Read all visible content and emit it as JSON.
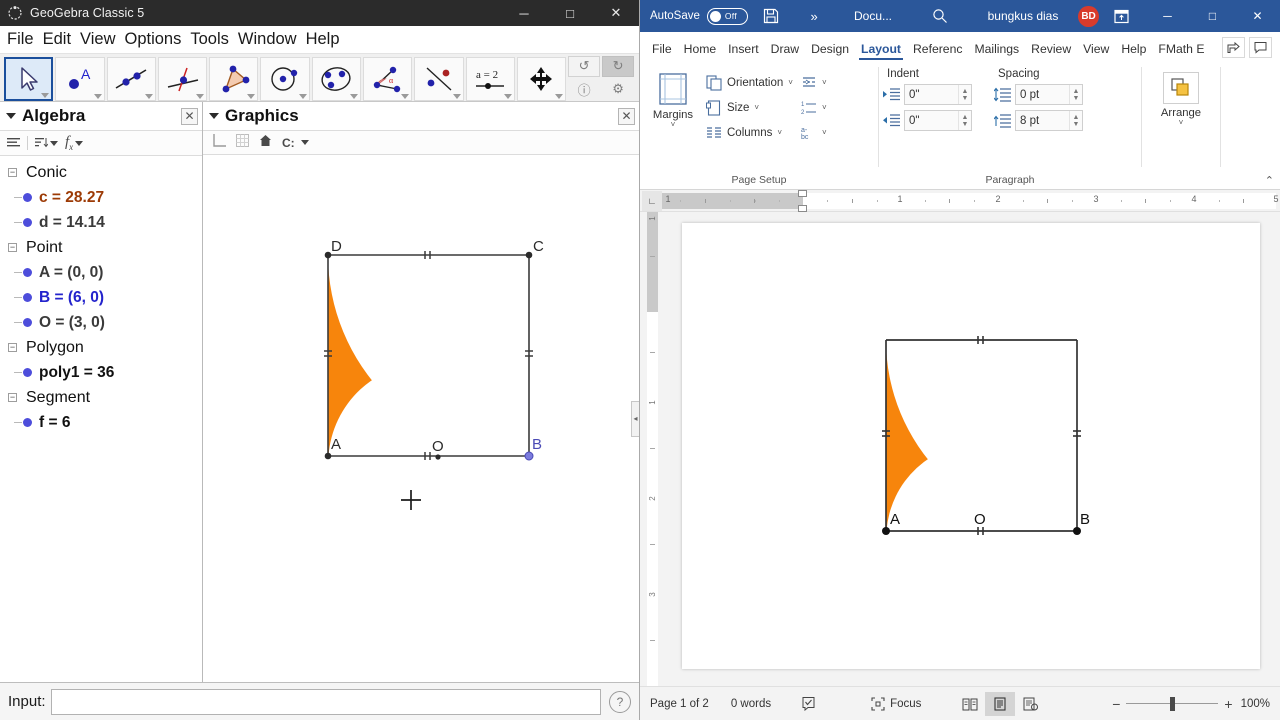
{
  "geogebra": {
    "window_title": "GeoGebra Classic 5",
    "window_buttons": {
      "minimize": "─",
      "maximize": "□",
      "close": "✕"
    },
    "menus": [
      "File",
      "Edit",
      "View",
      "Options",
      "Tools",
      "Window",
      "Help"
    ],
    "toolbar": {
      "tools": [
        {
          "name": "move-tool",
          "label": "Move",
          "active": true
        },
        {
          "name": "point-tool",
          "label": "Point",
          "active": false
        },
        {
          "name": "line-tool",
          "label": "Line",
          "active": false
        },
        {
          "name": "perpendicular-line-tool",
          "label": "Perpendicular Line",
          "active": false
        },
        {
          "name": "polygon-tool",
          "label": "Polygon",
          "active": false
        },
        {
          "name": "circle-tool",
          "label": "Circle with Center through Point",
          "active": false
        },
        {
          "name": "ellipse-tool",
          "label": "Ellipse",
          "active": false
        },
        {
          "name": "angle-tool",
          "label": "Angle",
          "active": false
        },
        {
          "name": "reflect-tool",
          "label": "Reflect about Line",
          "active": false
        },
        {
          "name": "slider-tool",
          "label": "a = 2",
          "active": false
        },
        {
          "name": "move-graphics-tool",
          "label": "Move Graphics View",
          "active": false
        }
      ],
      "undo": "undo-icon",
      "redo": "redo-icon",
      "help": "help-icon",
      "settings": "gear-icon"
    },
    "algebra_panel": {
      "title": "Algebra",
      "close": "✕",
      "tools": [
        "list-view-icon",
        "sort-icon",
        "input-help-icon"
      ],
      "groups": [
        {
          "name": "Conic",
          "items": [
            {
              "text": "c = 28.27",
              "color": "brown"
            },
            {
              "text": "d = 14.14",
              "color": "dark"
            }
          ]
        },
        {
          "name": "Point",
          "items": [
            {
              "text": "A = (0, 0)",
              "color": "dark"
            },
            {
              "text": "B = (6, 0)",
              "color": "blue"
            },
            {
              "text": "O = (3, 0)",
              "color": "dark"
            }
          ]
        },
        {
          "name": "Polygon",
          "items": [
            {
              "text": "poly1 = 36",
              "color": "black"
            }
          ]
        },
        {
          "name": "Segment",
          "items": [
            {
              "text": "f = 6",
              "color": "black"
            }
          ]
        }
      ]
    },
    "graphics_panel": {
      "title": "Graphics",
      "close": "✕",
      "tools": [
        "axes-icon",
        "grid-icon",
        "home-icon",
        "capture-icon"
      ],
      "figure": {
        "labels": {
          "A": "A",
          "B": "B",
          "C": "C",
          "D": "D",
          "O": "O"
        },
        "shaded_color": "#F7850C",
        "outline_color": "#3a3a3a",
        "point_B_color": "#7b7bdd"
      }
    },
    "input_bar": {
      "label": "Input:",
      "value": "",
      "help": "?"
    }
  },
  "word": {
    "quick_access": {
      "autosave_label": "AutoSave",
      "autosave_state": "Off",
      "save_icon": "save-icon",
      "more_icon": "»",
      "document_name": "Docu...",
      "search_icon": "search-icon",
      "user_name": "bungkus dias",
      "user_initials": "BD",
      "ribbon_display_icon": "ribbon-display-icon",
      "minimize": "─",
      "maximize": "□",
      "close": "✕"
    },
    "tabs": [
      {
        "label": "File",
        "active": false
      },
      {
        "label": "Home",
        "active": false
      },
      {
        "label": "Insert",
        "active": false
      },
      {
        "label": "Draw",
        "active": false
      },
      {
        "label": "Design",
        "active": false
      },
      {
        "label": "Layout",
        "active": true
      },
      {
        "label": "Referenc",
        "active": false
      },
      {
        "label": "Mailings",
        "active": false
      },
      {
        "label": "Review",
        "active": false
      },
      {
        "label": "View",
        "active": false
      },
      {
        "label": "Help",
        "active": false
      },
      {
        "label": "FMath E",
        "active": false
      }
    ],
    "tab_right_icons": [
      "share-icon",
      "comments-icon"
    ],
    "ribbon": {
      "page_setup": {
        "label": "Page Setup",
        "margins": "Margins",
        "orientation": "Orientation",
        "size": "Size",
        "columns": "Columns",
        "breaks_icon": "breaks-icon",
        "line_numbers_icon": "line-numbers-icon",
        "hyphenation_icon": "hyphenation-icon"
      },
      "paragraph": {
        "label": "Paragraph",
        "indent_label": "Indent",
        "spacing_label": "Spacing",
        "indent_left": "0\"",
        "indent_right": "0\"",
        "spacing_before": "0 pt",
        "spacing_after": "8 pt"
      },
      "arrange": {
        "label": "Arrange"
      },
      "collapse_icon": "⌃"
    },
    "ruler": {
      "horizontal_numbers": [
        "1",
        "1",
        "2",
        "3",
        "4",
        "5"
      ],
      "vertical_numbers": [
        "1",
        "1",
        "2",
        "3"
      ]
    },
    "document": {
      "figure": {
        "labels": {
          "A": "A",
          "B": "B",
          "O": "O"
        },
        "shaded_color": "#F7850C",
        "outline_color": "#333333"
      }
    },
    "status_bar": {
      "page": "Page 1 of 2",
      "words": "0 words",
      "proofing_icon": "proofing-icon",
      "focus_label": "Focus",
      "read_mode_icon": "read-mode-icon",
      "print_layout_icon": "print-layout-icon",
      "web_layout_icon": "web-layout-icon",
      "zoom_out": "−",
      "zoom_in": "+",
      "zoom_value": "100%"
    }
  }
}
